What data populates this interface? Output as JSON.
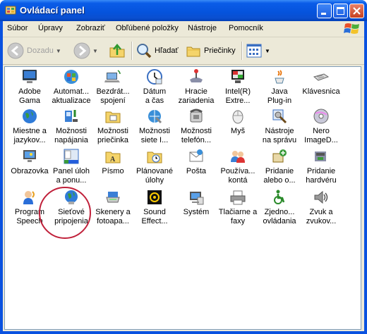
{
  "window": {
    "title": "Ovládací panel"
  },
  "menu": [
    "Súbor",
    "Úpravy",
    "Zobraziť",
    "Obľúbené položky",
    "Nástroje",
    "Pomocník"
  ],
  "toolbar": {
    "back_label": "Dozadu",
    "search_label": "Hľadať",
    "folders_label": "Priečinky"
  },
  "items": [
    {
      "l1": "Adobe",
      "l2": "Gama",
      "icon": "monitor-icon"
    },
    {
      "l1": "Automat...",
      "l2": "aktualizace",
      "icon": "windows-update-icon"
    },
    {
      "l1": "Bezdrát...",
      "l2": "spojení",
      "icon": "wireless-laptop-icon"
    },
    {
      "l1": "Dátum",
      "l2": "a čas",
      "icon": "clock-icon"
    },
    {
      "l1": "Hracie",
      "l2": "zariadenia",
      "icon": "joystick-icon"
    },
    {
      "l1": "Intel(R)",
      "l2": "Extre...",
      "icon": "intel-graphics-icon"
    },
    {
      "l1": "Java",
      "l2": "Plug-in",
      "icon": "java-icon"
    },
    {
      "l1": "Klávesnica",
      "l2": "",
      "icon": "keyboard-icon"
    },
    {
      "l1": "Miestne a",
      "l2": "jazykov...",
      "icon": "globe-icon"
    },
    {
      "l1": "Možnosti",
      "l2": "napájania",
      "icon": "power-icon"
    },
    {
      "l1": "Možnosti",
      "l2": "priečinka",
      "icon": "folder-icon"
    },
    {
      "l1": "Možnosti",
      "l2": "siete I...",
      "icon": "internet-options-icon"
    },
    {
      "l1": "Možnosti",
      "l2": "telefón...",
      "icon": "phone-icon"
    },
    {
      "l1": "Myš",
      "l2": "",
      "icon": "mouse-icon"
    },
    {
      "l1": "Nástroje",
      "l2": "na správu",
      "icon": "admin-tools-icon"
    },
    {
      "l1": "Nero",
      "l2": "ImageD...",
      "icon": "nero-icon"
    },
    {
      "l1": "Obrazovka",
      "l2": "",
      "icon": "display-icon"
    },
    {
      "l1": "Panel úloh",
      "l2": "a ponu...",
      "icon": "taskbar-icon"
    },
    {
      "l1": "Písmo",
      "l2": "",
      "icon": "fonts-folder-icon"
    },
    {
      "l1": "Plánované",
      "l2": "úlohy",
      "icon": "scheduled-tasks-icon"
    },
    {
      "l1": "Pošta",
      "l2": "",
      "icon": "mail-icon"
    },
    {
      "l1": "Používa...",
      "l2": "kontá",
      "icon": "users-icon"
    },
    {
      "l1": "Pridanie",
      "l2": "alebo o...",
      "icon": "add-remove-icon"
    },
    {
      "l1": "Pridanie",
      "l2": "hardvéru",
      "icon": "add-hardware-icon"
    },
    {
      "l1": "Program",
      "l2": "Speech",
      "icon": "speech-icon"
    },
    {
      "l1": "Sieťové",
      "l2": "pripojenia",
      "icon": "network-connections-icon"
    },
    {
      "l1": "Skenery a",
      "l2": "fotoapa...",
      "icon": "scanner-icon"
    },
    {
      "l1": "Sound",
      "l2": "Effect...",
      "icon": "sound-effect-icon"
    },
    {
      "l1": "Systém",
      "l2": "",
      "icon": "system-icon"
    },
    {
      "l1": "Tlačiarne a",
      "l2": "faxy",
      "icon": "printer-icon"
    },
    {
      "l1": "Zjedno...",
      "l2": "ovládania",
      "icon": "accessibility-icon"
    },
    {
      "l1": "Zvuk a",
      "l2": "zvukov...",
      "icon": "speaker-icon"
    }
  ],
  "colors": {
    "titlebar": "#0553dc",
    "highlight_circle": "#c0203a"
  }
}
